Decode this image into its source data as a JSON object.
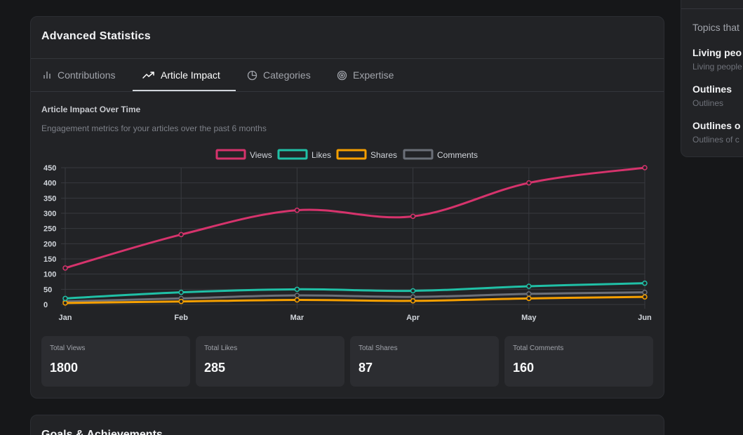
{
  "card": {
    "title": "Advanced Statistics"
  },
  "tabs": [
    {
      "label": "Contributions",
      "icon": "bar-chart-icon"
    },
    {
      "label": "Article Impact",
      "icon": "trending-up-icon",
      "active": true
    },
    {
      "label": "Categories",
      "icon": "pie-chart-icon"
    },
    {
      "label": "Expertise",
      "icon": "target-icon"
    }
  ],
  "section": {
    "title": "Article Impact Over Time",
    "subtitle": "Engagement metrics for your articles over the past 6 months"
  },
  "chart_data": {
    "type": "line",
    "categories": [
      "Jan",
      "Feb",
      "Mar",
      "Apr",
      "May",
      "Jun"
    ],
    "ylim": [
      0,
      450
    ],
    "yticks": [
      0,
      50,
      100,
      150,
      200,
      250,
      300,
      350,
      400,
      450
    ],
    "grid": true,
    "legend": "top-center",
    "series": [
      {
        "name": "Views",
        "color": "#d6336c",
        "values": [
          120,
          230,
          310,
          290,
          400,
          450
        ]
      },
      {
        "name": "Likes",
        "color": "#20c0a6",
        "values": [
          20,
          40,
          50,
          45,
          60,
          70
        ]
      },
      {
        "name": "Shares",
        "color": "#f59f00",
        "values": [
          5,
          10,
          15,
          12,
          20,
          25
        ]
      },
      {
        "name": "Comments",
        "color": "#6b6f78",
        "values": [
          10,
          20,
          30,
          25,
          35,
          40
        ]
      }
    ]
  },
  "stats": [
    {
      "label": "Total Views",
      "value": "1800"
    },
    {
      "label": "Total Likes",
      "value": "285"
    },
    {
      "label": "Total Shares",
      "value": "87"
    },
    {
      "label": "Total Comments",
      "value": "160"
    }
  ],
  "card2": {
    "title": "Goals & Achievements"
  },
  "sidebar": {
    "heading": "Topics that",
    "items": [
      {
        "title": "Living peo",
        "sub": "Living people"
      },
      {
        "title": "Outlines",
        "sub": "Outlines"
      },
      {
        "title": "Outlines o",
        "sub": "Outlines of c"
      }
    ]
  }
}
